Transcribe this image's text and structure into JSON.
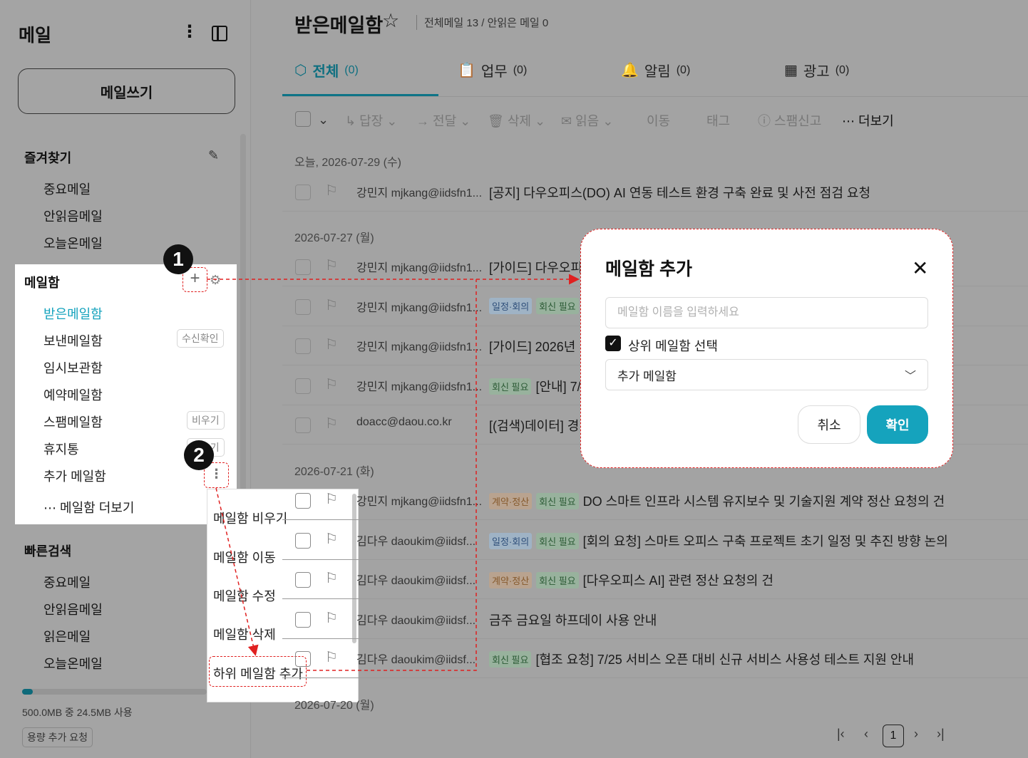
{
  "sidebar": {
    "title": "메일",
    "compose_label": "메일쓰기",
    "favorites": {
      "title": "즐겨찾기",
      "items": [
        "중요메일",
        "안읽음메일",
        "오늘온메일"
      ]
    },
    "mailboxes": {
      "title": "메일함",
      "items": [
        {
          "label": "받은메일함",
          "badge": ""
        },
        {
          "label": "보낸메일함",
          "badge": "수신확인"
        },
        {
          "label": "임시보관함",
          "badge": ""
        },
        {
          "label": "예약메일함",
          "badge": ""
        },
        {
          "label": "스팸메일함",
          "badge": "비우기"
        },
        {
          "label": "휴지통",
          "badge": "비우기"
        },
        {
          "label": "추가 메일함",
          "badge": ""
        }
      ],
      "more_label": "메일함 더보기"
    },
    "quick_search": {
      "title": "빠른검색",
      "items": [
        "중요메일",
        "안읽음메일",
        "읽은메일",
        "오늘온메일"
      ]
    },
    "storage": {
      "text": "500.0MB 중 24.5MB 사용",
      "used_fraction": 0.049,
      "request_label": "용량 추가 요청"
    }
  },
  "context_menu": {
    "items": [
      "메일함 비우기",
      "메일함 이동",
      "메일함 수정",
      "메일함 삭제",
      "하위 메일함 추가"
    ]
  },
  "markers": [
    "1",
    "2"
  ],
  "main": {
    "title": "받은메일함",
    "counts": "전체메일 13 / 안읽은 메일 0",
    "tabs": [
      {
        "label": "전체",
        "count": "(0)",
        "icon": "cube-icon"
      },
      {
        "label": "업무",
        "count": "(0)",
        "icon": "clipboard-icon"
      },
      {
        "label": "알림",
        "count": "(0)",
        "icon": "bell-icon"
      },
      {
        "label": "광고",
        "count": "(0)",
        "icon": "film-icon"
      }
    ],
    "toolbar": {
      "reply": "답장",
      "forward": "전달",
      "delete": "삭제",
      "read": "읽음",
      "move": "이동",
      "tag": "태그",
      "spam": "스팸신고",
      "more": "더보기"
    },
    "dates": [
      "오늘, 2026-07-29 (수)",
      "2026-07-27 (월)",
      "2026-07-21 (화)",
      "2026-07-20 (월)"
    ],
    "rows": [
      {
        "sender": "강민지 mjkang@iidsfn1...",
        "tags": [],
        "subject": "[공지] 다우오피스(DO) AI 연동 테스트 환경 구축 완료 및 사전 점검 요청"
      },
      {
        "sender": "강민지 mjkang@iidsfn1...",
        "tags": [],
        "subject": "[가이드] 다우오피스"
      },
      {
        "sender": "강민지 mjkang@iidsfn1...",
        "tags": [
          "일정·회의",
          "회신 필요"
        ],
        "subject": ""
      },
      {
        "sender": "강민지 mjkang@iidsfn1...",
        "tags": [],
        "subject": "[가이드] 2026년"
      },
      {
        "sender": "강민지 mjkang@iidsfn1...",
        "tags": [
          "회신 필요"
        ],
        "subject": "[안내] 7/"
      },
      {
        "sender": "doacc@daou.co.kr",
        "tags": [],
        "subject": "[(검색)데이터] 경"
      },
      {
        "sender": "강민지 mjkang@iidsfn1...",
        "tags": [
          "계약·정산",
          "회신 필요"
        ],
        "subject": "DO 스마트 인프라 시스템 유지보수 및 기술지원 계약 정산 요청의 건"
      },
      {
        "sender": "김다우 daoukim@iidsf...",
        "tags": [
          "일정·회의",
          "회신 필요"
        ],
        "subject": "[회의 요청] 스마트 오피스 구축 프로젝트 초기 일정 및 추진 방향 논의"
      },
      {
        "sender": "김다우 daoukim@iidsf...",
        "tags": [
          "계약·정산",
          "회신 필요"
        ],
        "subject": "[다우오피스 AI] 관련 정산 요청의 건"
      },
      {
        "sender": "김다우 daoukim@iidsf...",
        "tags": [],
        "subject": "금주 금요일 하프데이 사용 안내"
      },
      {
        "sender": "김다우 daoukim@iidsf...",
        "tags": [
          "회신 필요"
        ],
        "subject": "[협조 요청] 7/25 서비스 오픈 대비 신규 서비스 사용성 테스트 지원 안내"
      }
    ],
    "pagination": {
      "current": "1"
    }
  },
  "modal": {
    "title": "메일함 추가",
    "name_placeholder": "메일함 이름을 입력하세요",
    "parent_checkbox_label": "상위 메일함 선택",
    "parent_checked": true,
    "parent_value": "추가 메일함",
    "cancel_label": "취소",
    "confirm_label": "확인"
  },
  "colors": {
    "accent": "#15a3bd",
    "annotation": "#e02020",
    "tab_active": "#0e6f80"
  }
}
